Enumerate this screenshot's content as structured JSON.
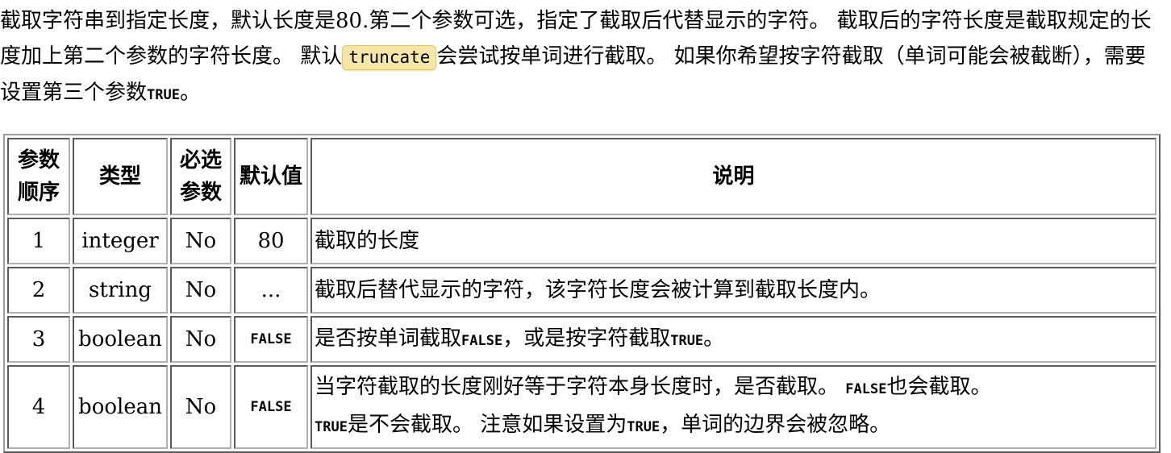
{
  "intro": {
    "part1": "截取字符串到指定长度，默认长度是80.第二个参数可选，指定了截取后代替显示的字符。 截取后的字符长度是截取规定的长度加上第二个参数的字符长度。 默认",
    "code": "truncate",
    "part2": "会尝试按单词进行截取。 如果你希望按字符截取（单词可能会被截断），需要设置第三个参数",
    "true_word": "TRUE",
    "part3": "。"
  },
  "table": {
    "headers": [
      "参数顺序",
      "类型",
      "必选参数",
      "默认值",
      "说明"
    ],
    "rows": [
      {
        "order": "1",
        "type": "integer",
        "required": "No",
        "default": "80",
        "desc": "截取的长度"
      },
      {
        "order": "2",
        "type": "string",
        "required": "No",
        "default": "...",
        "desc": "截取后替代显示的字符，该字符长度会被计算到截取长度内。"
      },
      {
        "order": "3",
        "type": "boolean",
        "required": "No",
        "default": "FALSE",
        "desc_a": "是否按单词截取",
        "desc_b": "FALSE",
        "desc_c": "，或是按字符截取",
        "desc_d": "TRUE",
        "desc_e": "。"
      },
      {
        "order": "4",
        "type": "boolean",
        "required": "No",
        "default": "FALSE",
        "desc_a": "当字符截取的长度刚好等于字符本身长度时，是否截取。 ",
        "desc_b": "FALSE",
        "desc_c": "也会截取。",
        "desc_d": "TRUE",
        "desc_e": "是不会截取。 注意如果设置为",
        "desc_f": "TRUE",
        "desc_g": "，单词的边界会被忽略。"
      }
    ]
  }
}
